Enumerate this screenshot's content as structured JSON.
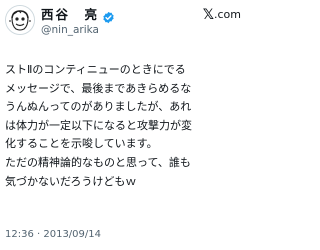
{
  "author": {
    "display_name": "西谷　亮",
    "handle": "@nin_arika",
    "verified": true,
    "avatar_icon": "sketch-face-avatar-icon",
    "verified_icon": "verified-badge-icon"
  },
  "platform": {
    "logo_glyph": "𝕏",
    "suffix": ".com"
  },
  "tweet": {
    "lines": [
      "ストⅡのコンティニューのときにでる",
      "メッセージで、最後まであきらめるな",
      "うんぬんってのがありましたが、あれ",
      "は体力が一定以下になると攻撃力が変",
      "化することを示唆しています。",
      "ただの精神論的なものと思って、誰も",
      "気づかないだろうけどもｗ"
    ]
  },
  "meta": {
    "timestamp": "12:36 · 2013/09/14"
  },
  "colors": {
    "text": "#0f1419",
    "secondary": "#536471",
    "verified": "#1d9bf0",
    "background": "#ffffff"
  }
}
